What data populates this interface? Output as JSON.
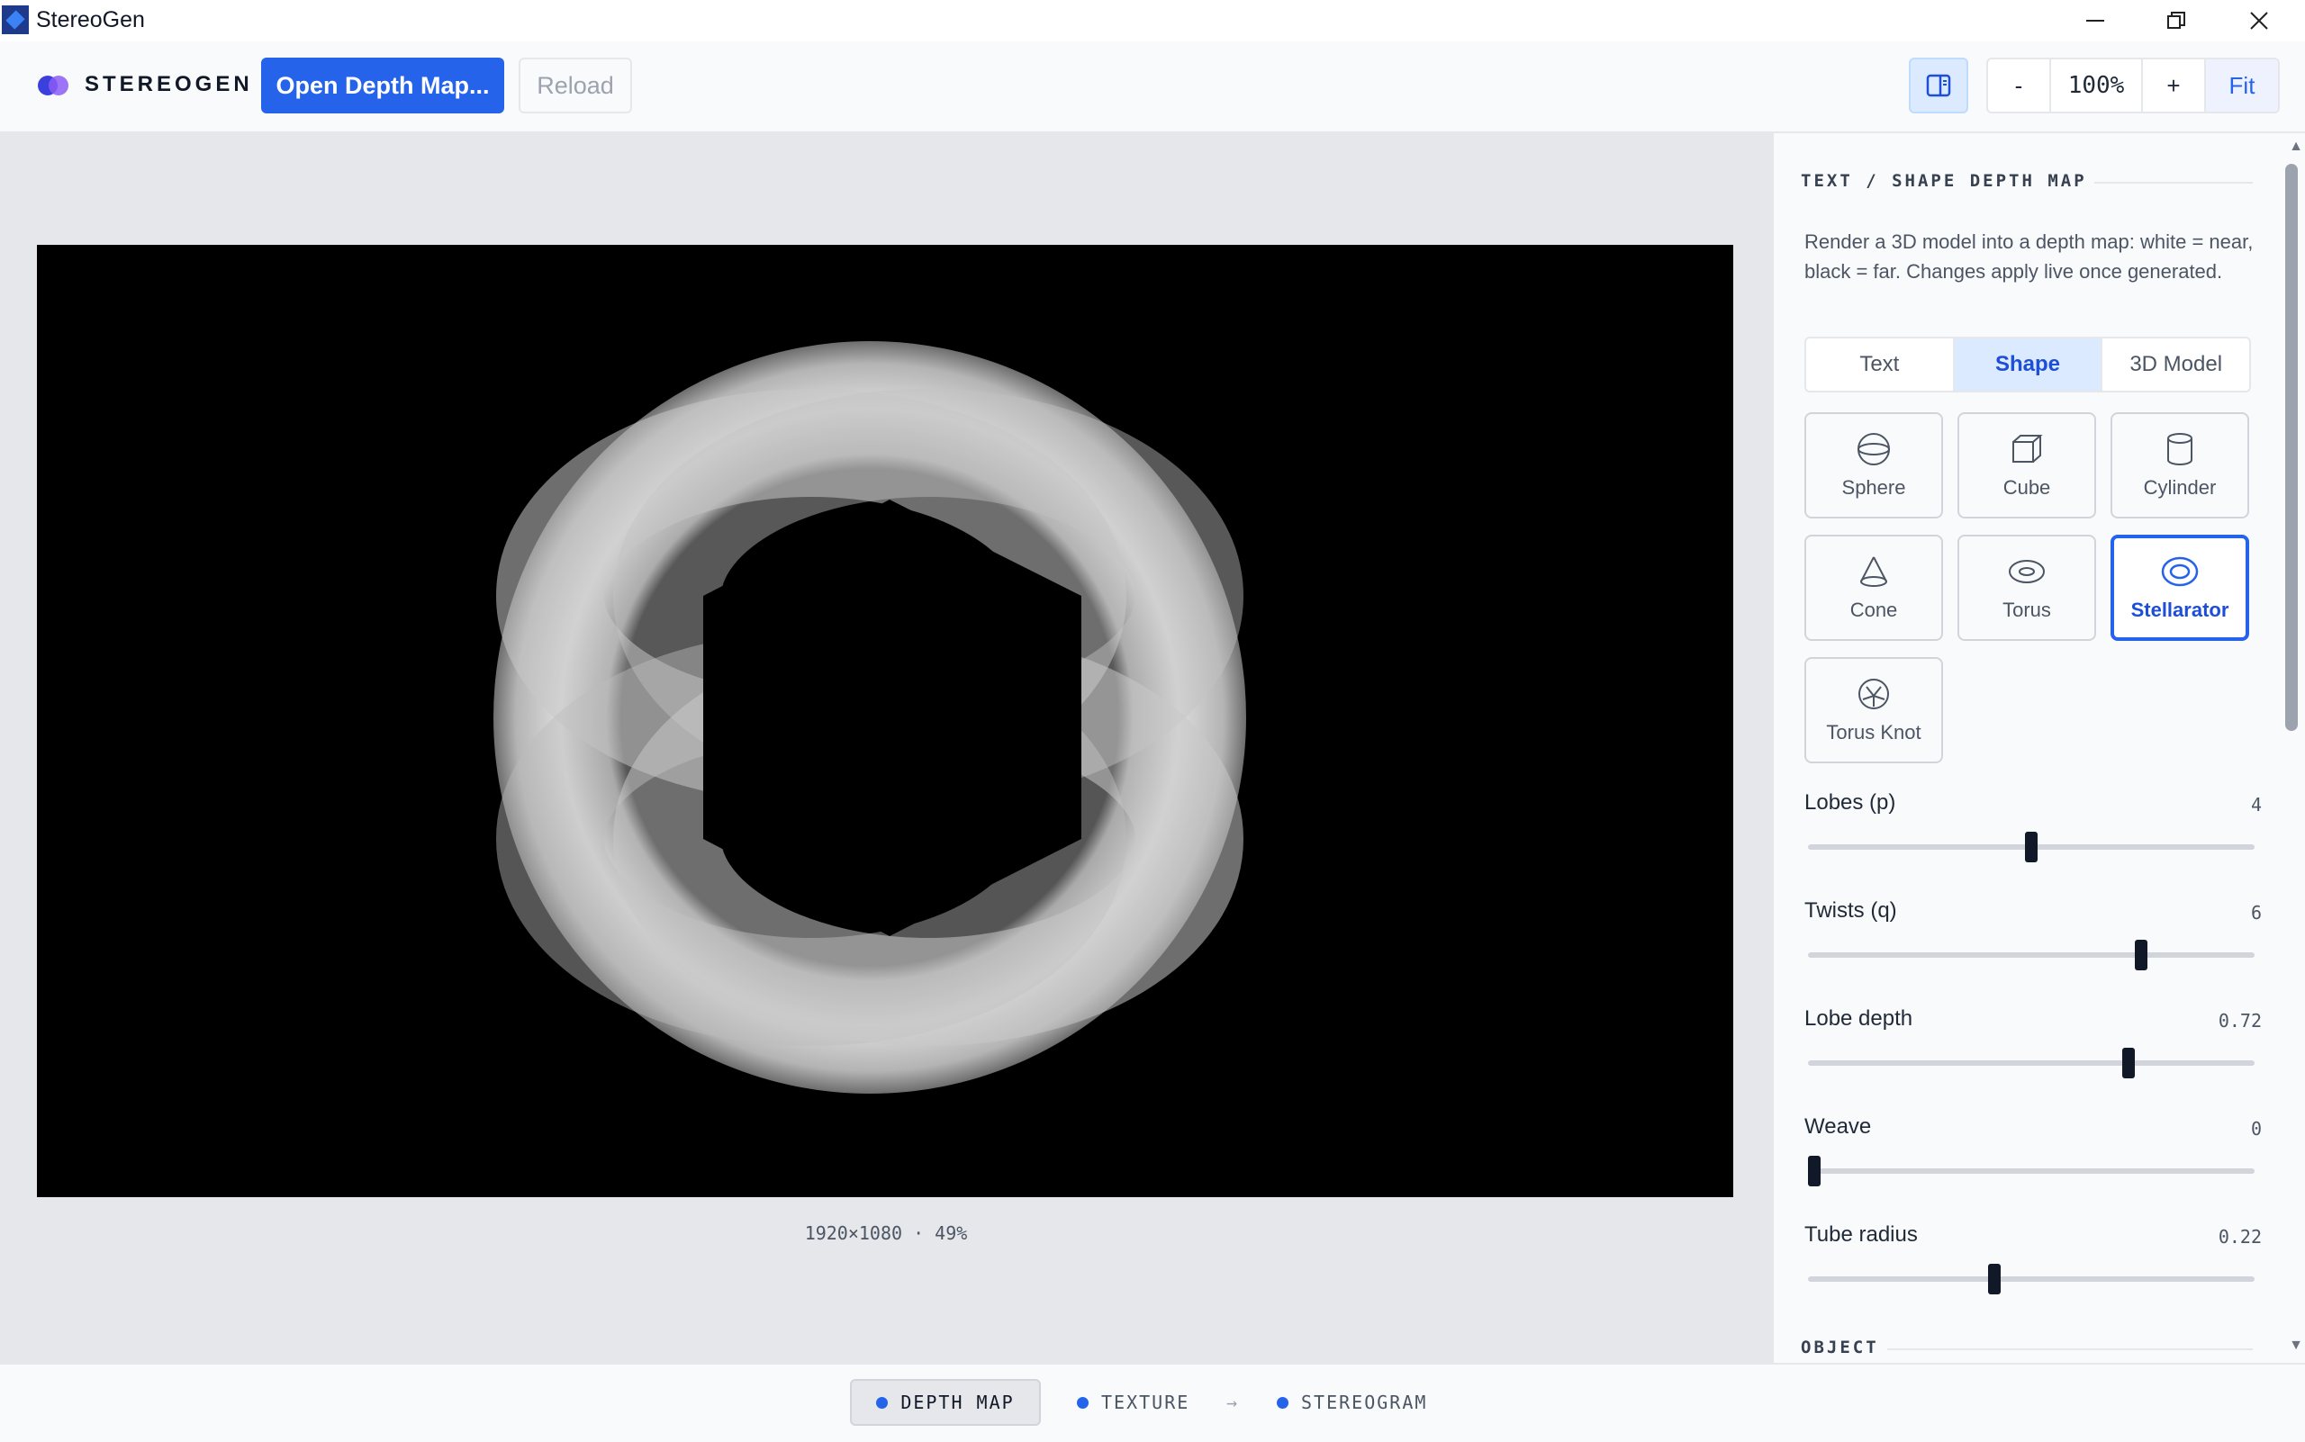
{
  "window": {
    "title": "StereoGen",
    "controls": [
      "minimize",
      "restore",
      "close"
    ]
  },
  "header": {
    "brand": "STEREOGEN",
    "open_button": "Open Depth Map...",
    "reload_button": "Reload",
    "zoom": {
      "minus": "-",
      "level": "100%",
      "plus": "+",
      "fit": "Fit"
    }
  },
  "canvas": {
    "info": "1920×1080 · 49%"
  },
  "panel": {
    "section_title": "TEXT / SHAPE DEPTH MAP",
    "description": "Render a 3D model into a depth map: white = near, black = far. Changes apply live once generated.",
    "mode_tabs": [
      {
        "label": "Text",
        "active": false
      },
      {
        "label": "Shape",
        "active": true
      },
      {
        "label": "3D Model",
        "active": false
      }
    ],
    "shapes": [
      {
        "label": "Sphere",
        "icon": "sphere-icon",
        "selected": false
      },
      {
        "label": "Cube",
        "icon": "cube-icon",
        "selected": false
      },
      {
        "label": "Cylinder",
        "icon": "cylinder-icon",
        "selected": false
      },
      {
        "label": "Cone",
        "icon": "cone-icon",
        "selected": false
      },
      {
        "label": "Torus",
        "icon": "torus-icon",
        "selected": false
      },
      {
        "label": "Stellarator",
        "icon": "stellarator-icon",
        "selected": true
      },
      {
        "label": "Torus Knot",
        "icon": "torus-knot-icon",
        "selected": false
      }
    ],
    "sliders": [
      {
        "label": "Lobes (p)",
        "value": "4",
        "fraction": 0.5
      },
      {
        "label": "Twists (q)",
        "value": "6",
        "fraction": 0.745
      },
      {
        "label": "Lobe depth",
        "value": "0.72",
        "fraction": 0.717
      },
      {
        "label": "Weave",
        "value": "0",
        "fraction": 0.0
      },
      {
        "label": "Tube radius",
        "value": "0.22",
        "fraction": 0.417
      }
    ],
    "next_section": "OBJECT"
  },
  "pipeline": {
    "steps": [
      {
        "label": "DEPTH MAP",
        "active": true
      },
      {
        "label": "TEXTURE",
        "active": false
      },
      {
        "label": "STEREOGRAM",
        "active": false
      }
    ],
    "arrow": "→"
  },
  "colors": {
    "accent": "#2563eb",
    "accent_light": "#dbeafe",
    "canvas_bg": "#000000",
    "panel_bg": "#f9fafb"
  }
}
